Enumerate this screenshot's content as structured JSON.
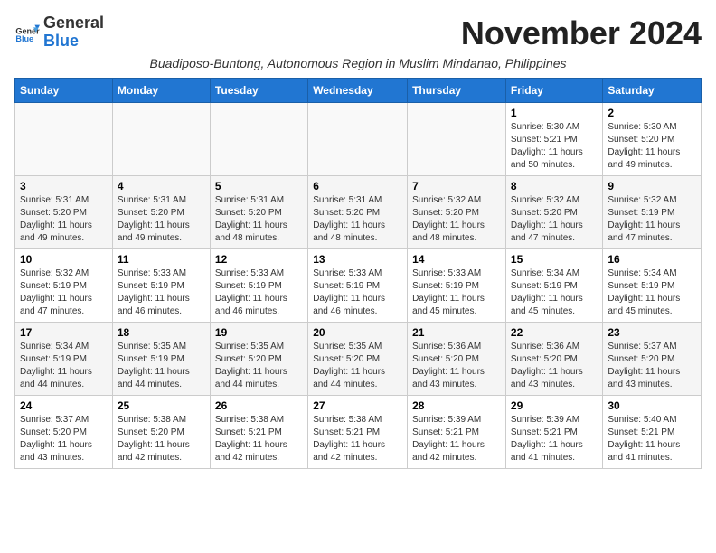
{
  "header": {
    "logo_general": "General",
    "logo_blue": "Blue",
    "month_title": "November 2024",
    "subtitle": "Buadiposo-Buntong, Autonomous Region in Muslim Mindanao, Philippines"
  },
  "days_of_week": [
    "Sunday",
    "Monday",
    "Tuesday",
    "Wednesday",
    "Thursday",
    "Friday",
    "Saturday"
  ],
  "weeks": [
    [
      {
        "day": "",
        "info": ""
      },
      {
        "day": "",
        "info": ""
      },
      {
        "day": "",
        "info": ""
      },
      {
        "day": "",
        "info": ""
      },
      {
        "day": "",
        "info": ""
      },
      {
        "day": "1",
        "info": "Sunrise: 5:30 AM\nSunset: 5:21 PM\nDaylight: 11 hours and 50 minutes."
      },
      {
        "day": "2",
        "info": "Sunrise: 5:30 AM\nSunset: 5:20 PM\nDaylight: 11 hours and 49 minutes."
      }
    ],
    [
      {
        "day": "3",
        "info": "Sunrise: 5:31 AM\nSunset: 5:20 PM\nDaylight: 11 hours and 49 minutes."
      },
      {
        "day": "4",
        "info": "Sunrise: 5:31 AM\nSunset: 5:20 PM\nDaylight: 11 hours and 49 minutes."
      },
      {
        "day": "5",
        "info": "Sunrise: 5:31 AM\nSunset: 5:20 PM\nDaylight: 11 hours and 48 minutes."
      },
      {
        "day": "6",
        "info": "Sunrise: 5:31 AM\nSunset: 5:20 PM\nDaylight: 11 hours and 48 minutes."
      },
      {
        "day": "7",
        "info": "Sunrise: 5:32 AM\nSunset: 5:20 PM\nDaylight: 11 hours and 48 minutes."
      },
      {
        "day": "8",
        "info": "Sunrise: 5:32 AM\nSunset: 5:20 PM\nDaylight: 11 hours and 47 minutes."
      },
      {
        "day": "9",
        "info": "Sunrise: 5:32 AM\nSunset: 5:19 PM\nDaylight: 11 hours and 47 minutes."
      }
    ],
    [
      {
        "day": "10",
        "info": "Sunrise: 5:32 AM\nSunset: 5:19 PM\nDaylight: 11 hours and 47 minutes."
      },
      {
        "day": "11",
        "info": "Sunrise: 5:33 AM\nSunset: 5:19 PM\nDaylight: 11 hours and 46 minutes."
      },
      {
        "day": "12",
        "info": "Sunrise: 5:33 AM\nSunset: 5:19 PM\nDaylight: 11 hours and 46 minutes."
      },
      {
        "day": "13",
        "info": "Sunrise: 5:33 AM\nSunset: 5:19 PM\nDaylight: 11 hours and 46 minutes."
      },
      {
        "day": "14",
        "info": "Sunrise: 5:33 AM\nSunset: 5:19 PM\nDaylight: 11 hours and 45 minutes."
      },
      {
        "day": "15",
        "info": "Sunrise: 5:34 AM\nSunset: 5:19 PM\nDaylight: 11 hours and 45 minutes."
      },
      {
        "day": "16",
        "info": "Sunrise: 5:34 AM\nSunset: 5:19 PM\nDaylight: 11 hours and 45 minutes."
      }
    ],
    [
      {
        "day": "17",
        "info": "Sunrise: 5:34 AM\nSunset: 5:19 PM\nDaylight: 11 hours and 44 minutes."
      },
      {
        "day": "18",
        "info": "Sunrise: 5:35 AM\nSunset: 5:19 PM\nDaylight: 11 hours and 44 minutes."
      },
      {
        "day": "19",
        "info": "Sunrise: 5:35 AM\nSunset: 5:20 PM\nDaylight: 11 hours and 44 minutes."
      },
      {
        "day": "20",
        "info": "Sunrise: 5:35 AM\nSunset: 5:20 PM\nDaylight: 11 hours and 44 minutes."
      },
      {
        "day": "21",
        "info": "Sunrise: 5:36 AM\nSunset: 5:20 PM\nDaylight: 11 hours and 43 minutes."
      },
      {
        "day": "22",
        "info": "Sunrise: 5:36 AM\nSunset: 5:20 PM\nDaylight: 11 hours and 43 minutes."
      },
      {
        "day": "23",
        "info": "Sunrise: 5:37 AM\nSunset: 5:20 PM\nDaylight: 11 hours and 43 minutes."
      }
    ],
    [
      {
        "day": "24",
        "info": "Sunrise: 5:37 AM\nSunset: 5:20 PM\nDaylight: 11 hours and 43 minutes."
      },
      {
        "day": "25",
        "info": "Sunrise: 5:38 AM\nSunset: 5:20 PM\nDaylight: 11 hours and 42 minutes."
      },
      {
        "day": "26",
        "info": "Sunrise: 5:38 AM\nSunset: 5:21 PM\nDaylight: 11 hours and 42 minutes."
      },
      {
        "day": "27",
        "info": "Sunrise: 5:38 AM\nSunset: 5:21 PM\nDaylight: 11 hours and 42 minutes."
      },
      {
        "day": "28",
        "info": "Sunrise: 5:39 AM\nSunset: 5:21 PM\nDaylight: 11 hours and 42 minutes."
      },
      {
        "day": "29",
        "info": "Sunrise: 5:39 AM\nSunset: 5:21 PM\nDaylight: 11 hours and 41 minutes."
      },
      {
        "day": "30",
        "info": "Sunrise: 5:40 AM\nSunset: 5:21 PM\nDaylight: 11 hours and 41 minutes."
      }
    ]
  ]
}
